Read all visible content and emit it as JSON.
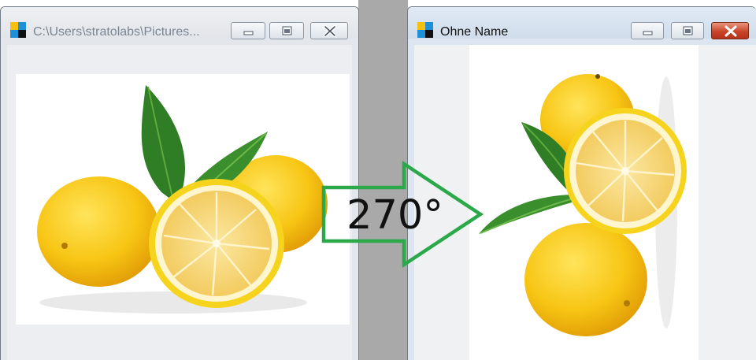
{
  "left_window": {
    "title": "C:\\Users\\stratolabs\\Pictures...",
    "icon": "app-icon",
    "controls": [
      "minimize-icon",
      "maximize-icon",
      "close-icon"
    ],
    "state": "inactive"
  },
  "right_window": {
    "title": "Ohne Name",
    "icon": "app-icon",
    "controls": [
      "minimize-icon",
      "maximize-icon",
      "close-icon"
    ],
    "state": "active"
  },
  "annotation": {
    "rotation_label": "270°",
    "arrow_color": "#2aa84a"
  },
  "colors": {
    "lemon": "#f6c414",
    "leaf": "#2f8a2a",
    "close_active": "#c9452a"
  }
}
